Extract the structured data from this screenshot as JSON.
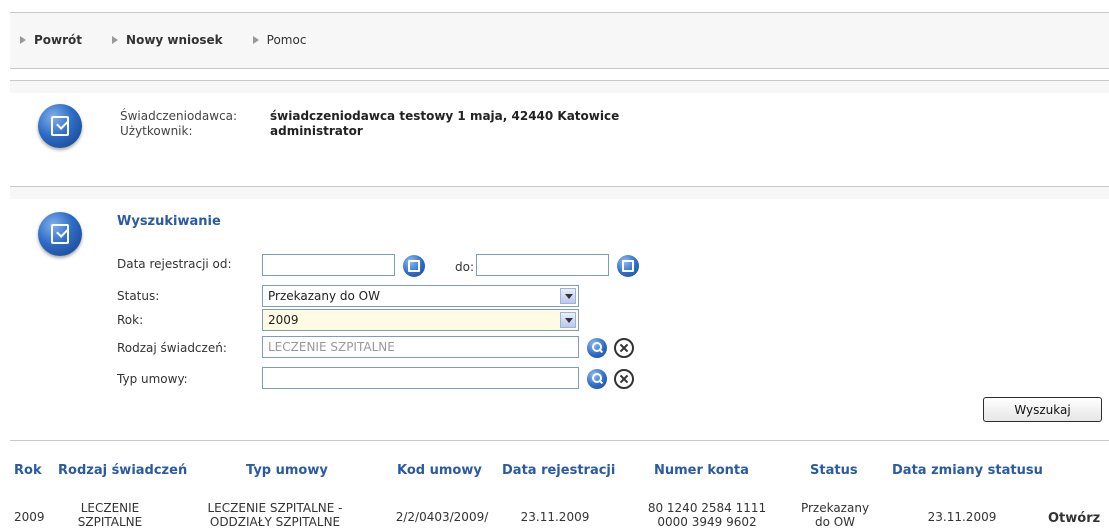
{
  "nav": {
    "back": "Powrót",
    "new_request": "Nowy wniosek",
    "help": "Pomoc"
  },
  "info": {
    "provider_label": "Świadczeniodawca:",
    "provider_value": "świadczeniodawca testowy 1 maja, 42440 Katowice",
    "user_label": "Użytkownik:",
    "user_value": "administrator"
  },
  "search": {
    "title": "Wyszukiwanie",
    "date_from_label": "Data rejestracji od:",
    "date_from_value": "",
    "date_to_label": "do:",
    "date_to_value": "",
    "status_label": "Status:",
    "status_value": "Przekazany do OW",
    "year_label": "Rok:",
    "year_value": "2009",
    "benefit_type_label": "Rodzaj świadczeń:",
    "benefit_type_value": "LECZENIE SZPITALNE",
    "contract_type_label": "Typ umowy:",
    "contract_type_value": "",
    "search_button": "Wyszukaj"
  },
  "table": {
    "headers": [
      "Rok",
      "Rodzaj świadczeń",
      "Typ umowy",
      "Kod umowy",
      "Data rejestracji",
      "Numer konta",
      "Status",
      "Data zmiany statusu"
    ],
    "rows": [
      {
        "year": "2009",
        "benefit_type_1": "LECZENIE",
        "benefit_type_2": "SZPITALNE",
        "contract_type_1": "LECZENIE SZPITALNE -",
        "contract_type_2": "ODDZIAŁY SZPITALNE",
        "contract_code": "2/2/0403/2009/",
        "reg_date": "23.11.2009",
        "account_1": "80 1240 2584 1111",
        "account_2": "0000 3949 9602",
        "status_1": "Przekazany",
        "status_2": "do OW",
        "status_change_date": "23.11.2009",
        "action": "Otwórz"
      }
    ]
  }
}
